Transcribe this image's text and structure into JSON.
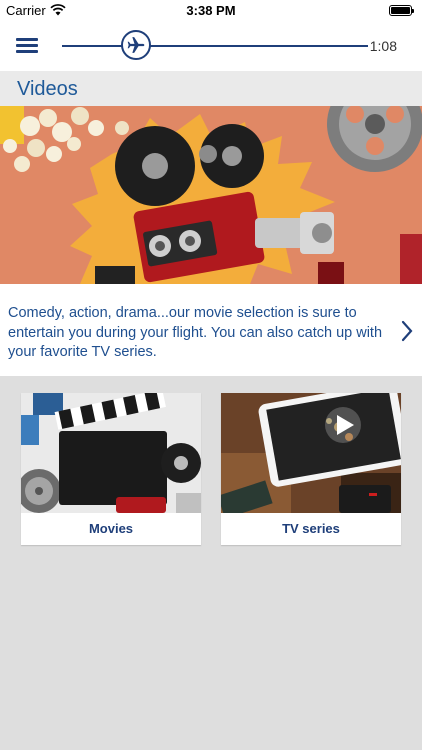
{
  "status": {
    "carrier": "Carrier",
    "time": "3:38 PM"
  },
  "nav": {
    "flight_time": "1:08",
    "progress": 0.22,
    "menu_icon": "hamburger-menu-icon",
    "plane_icon": "airplane-icon"
  },
  "section": {
    "title": "Videos"
  },
  "description": {
    "text": "Comedy, action, drama...our movie selection is sure to entertain you during your flight. You can also catch up with your favorite TV series."
  },
  "categories": [
    {
      "label": "Movies"
    },
    {
      "label": "TV series"
    }
  ],
  "colors": {
    "accent": "#1f3f7a",
    "link_text": "#1f4f8f",
    "title": "#1f5a99",
    "hero_bg": "#e08865"
  }
}
